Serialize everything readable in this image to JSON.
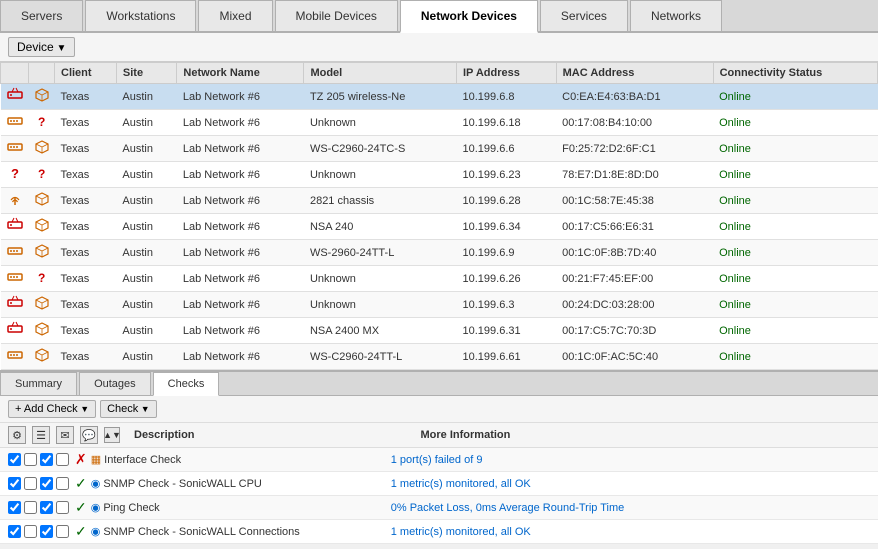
{
  "tabs": [
    {
      "id": "servers",
      "label": "Servers",
      "active": false
    },
    {
      "id": "workstations",
      "label": "Workstations",
      "active": false
    },
    {
      "id": "mixed",
      "label": "Mixed",
      "active": false
    },
    {
      "id": "mobile-devices",
      "label": "Mobile Devices",
      "active": false
    },
    {
      "id": "network-devices",
      "label": "Network Devices",
      "active": true
    },
    {
      "id": "services",
      "label": "Services",
      "active": false
    },
    {
      "id": "networks",
      "label": "Networks",
      "active": false
    }
  ],
  "toolbar": {
    "device_label": "Device"
  },
  "table": {
    "columns": [
      "",
      "",
      "Client",
      "Site",
      "Network Name",
      "Model",
      "IP Address",
      "MAC Address",
      "Connectivity Status"
    ],
    "rows": [
      {
        "icon1": "router",
        "icon2": "cube",
        "client": "Texas",
        "site": "Austin",
        "network": "Lab Network #6",
        "model": "TZ 205 wireless-Ne",
        "ip": "10.199.6.8",
        "mac": "C0:EA:E4:63:BA:D1",
        "status": "Online",
        "selected": true
      },
      {
        "icon1": "switch",
        "icon2": "question",
        "client": "Texas",
        "site": "Austin",
        "network": "Lab Network #6",
        "model": "Unknown",
        "ip": "10.199.6.18",
        "mac": "00:17:08:B4:10:00",
        "status": "Online",
        "selected": false
      },
      {
        "icon1": "switch",
        "icon2": "cube",
        "client": "Texas",
        "site": "Austin",
        "network": "Lab Network #6",
        "model": "WS-C2960-24TC-S",
        "ip": "10.199.6.6",
        "mac": "F0:25:72:D2:6F:C1",
        "status": "Online",
        "selected": false
      },
      {
        "icon1": "question",
        "icon2": "question",
        "client": "Texas",
        "site": "Austin",
        "network": "Lab Network #6",
        "model": "Unknown",
        "ip": "10.199.6.23",
        "mac": "78:E7:D1:8E:8D:D0",
        "status": "Online",
        "selected": false
      },
      {
        "icon1": "antenna",
        "icon2": "cube",
        "client": "Texas",
        "site": "Austin",
        "network": "Lab Network #6",
        "model": "2821 chassis",
        "ip": "10.199.6.28",
        "mac": "00:1C:58:7E:45:38",
        "status": "Online",
        "selected": false
      },
      {
        "icon1": "router",
        "icon2": "cube",
        "client": "Texas",
        "site": "Austin",
        "network": "Lab Network #6",
        "model": "NSA 240",
        "ip": "10.199.6.34",
        "mac": "00:17:C5:66:E6:31",
        "status": "Online",
        "selected": false
      },
      {
        "icon1": "switch",
        "icon2": "cube",
        "client": "Texas",
        "site": "Austin",
        "network": "Lab Network #6",
        "model": "WS-2960-24TT-L",
        "ip": "10.199.6.9",
        "mac": "00:1C:0F:8B:7D:40",
        "status": "Online",
        "selected": false
      },
      {
        "icon1": "switch",
        "icon2": "question",
        "client": "Texas",
        "site": "Austin",
        "network": "Lab Network #6",
        "model": "Unknown",
        "ip": "10.199.6.26",
        "mac": "00:21:F7:45:EF:00",
        "status": "Online",
        "selected": false
      },
      {
        "icon1": "router",
        "icon2": "cube",
        "client": "Texas",
        "site": "Austin",
        "network": "Lab Network #6",
        "model": "Unknown",
        "ip": "10.199.6.3",
        "mac": "00:24:DC:03:28:00",
        "status": "Online",
        "selected": false
      },
      {
        "icon1": "router",
        "icon2": "cube",
        "client": "Texas",
        "site": "Austin",
        "network": "Lab Network #6",
        "model": "NSA 2400 MX",
        "ip": "10.199.6.31",
        "mac": "00:17:C5:7C:70:3D",
        "status": "Online",
        "selected": false
      },
      {
        "icon1": "switch",
        "icon2": "cube",
        "client": "Texas",
        "site": "Austin",
        "network": "Lab Network #6",
        "model": "WS-C2960-24TT-L",
        "ip": "10.199.6.61",
        "mac": "00:1C:0F:AC:5C:40",
        "status": "Online",
        "selected": false
      }
    ]
  },
  "bottom": {
    "tabs": [
      {
        "id": "summary",
        "label": "Summary",
        "active": false
      },
      {
        "id": "outages",
        "label": "Outages",
        "active": false
      },
      {
        "id": "checks",
        "label": "Checks",
        "active": true
      }
    ],
    "add_check_label": "Add Check",
    "check_label": "Check",
    "checks_columns": [
      "",
      "",
      "",
      "",
      "",
      "",
      "Description",
      "More Information"
    ],
    "checks": [
      {
        "cb1": true,
        "cb2": false,
        "cb3": true,
        "cb4": false,
        "status": "fail",
        "icon": "network",
        "description": "Interface Check",
        "info": "1 port(s) failed of 9",
        "info_link": true
      },
      {
        "cb1": true,
        "cb2": false,
        "cb3": true,
        "cb4": false,
        "status": "ok",
        "icon": "snmp",
        "description": "SNMP Check - SonicWALL CPU",
        "info": "1 metric(s) monitored, all OK",
        "info_link": true
      },
      {
        "cb1": true,
        "cb2": false,
        "cb3": true,
        "cb4": false,
        "status": "ok",
        "icon": "ping",
        "description": "Ping Check",
        "info": "0% Packet Loss, 0ms Average Round-Trip Time",
        "info_link": true
      },
      {
        "cb1": true,
        "cb2": false,
        "cb3": true,
        "cb4": false,
        "status": "ok",
        "icon": "snmp",
        "description": "SNMP Check - SonicWALL Connections",
        "info": "1 metric(s) monitored, all OK",
        "info_link": true
      }
    ]
  }
}
